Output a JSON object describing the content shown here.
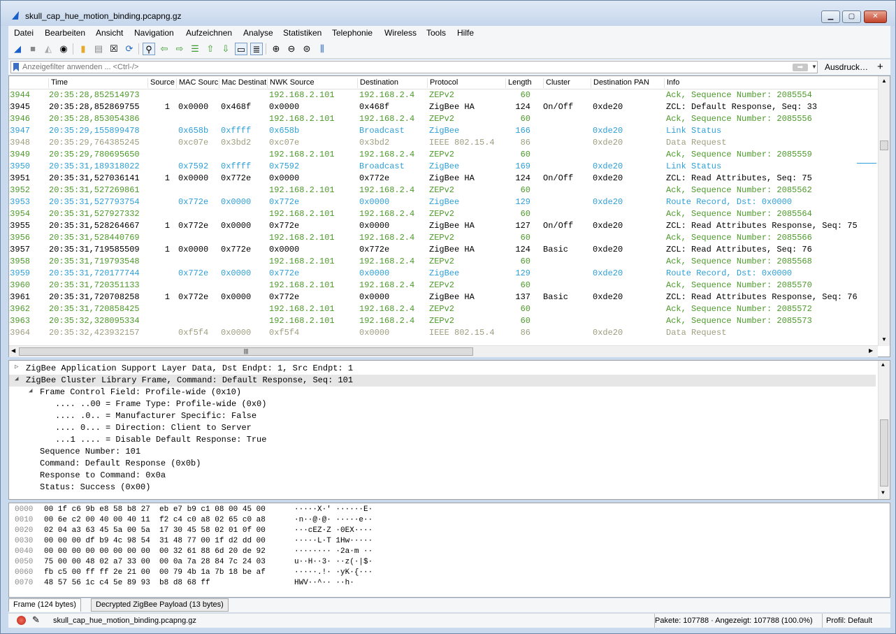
{
  "window": {
    "title": "skull_cap_hue_motion_binding.pcapng.gz"
  },
  "menu": [
    "Datei",
    "Bearbeiten",
    "Ansicht",
    "Navigation",
    "Aufzeichnen",
    "Analyse",
    "Statistiken",
    "Telephonie",
    "Wireless",
    "Tools",
    "Hilfe"
  ],
  "filter": {
    "placeholder": "Anzeigefilter anwenden ... <Ctrl-/>",
    "print_label": "Ausdruck…",
    "add_label": "+"
  },
  "columns": [
    "Time",
    "Source",
    "MAC Source",
    "Mac Destinat",
    "NWK Source",
    "Destination",
    "Protocol",
    "Length",
    "Cluster",
    "Destination PAN",
    "Info"
  ],
  "packets": [
    {
      "no": "23944",
      "time": "20:35:28,852514973",
      "src": "",
      "mac_src": "",
      "mac_dst": "",
      "nwk_src": "192.168.2.101",
      "dst": "192.168.2.4",
      "proto": "ZEPv2",
      "len": "60",
      "cluster": "",
      "dpan": "",
      "info": "Ack, Sequence Number: 2085554",
      "style": "zep"
    },
    {
      "no": "23945",
      "time": "20:35:28,852869755",
      "src": "1",
      "mac_src": "0x0000",
      "mac_dst": "0x468f",
      "nwk_src": "0x0000",
      "dst": "0x468f",
      "proto": "ZigBee HA",
      "len": "124",
      "cluster": "On/Off",
      "dpan": "0xde20",
      "info": "ZCL: Default Response, Seq: 33",
      "style": "ha"
    },
    {
      "no": "23946",
      "time": "20:35:28,853054386",
      "src": "",
      "mac_src": "",
      "mac_dst": "",
      "nwk_src": "192.168.2.101",
      "dst": "192.168.2.4",
      "proto": "ZEPv2",
      "len": "60",
      "cluster": "",
      "dpan": "",
      "info": "Ack, Sequence Number: 2085556",
      "style": "zep"
    },
    {
      "no": "23947",
      "time": "20:35:29,155899478",
      "src": "",
      "mac_src": "0x658b",
      "mac_dst": "0xffff",
      "nwk_src": "0x658b",
      "dst": "Broadcast",
      "proto": "ZigBee",
      "len": "166",
      "cluster": "",
      "dpan": "0xde20",
      "info": "Link Status",
      "style": "zb"
    },
    {
      "no": "23948",
      "time": "20:35:29,764385245",
      "src": "",
      "mac_src": "0xc07e",
      "mac_dst": "0x3bd2",
      "nwk_src": "0xc07e",
      "dst": "0x3bd2",
      "proto": "IEEE 802.15.4",
      "len": "86",
      "cluster": "",
      "dpan": "0xde20",
      "info": "Data Request",
      "style": "ieee"
    },
    {
      "no": "23949",
      "time": "20:35:29,780695650",
      "src": "",
      "mac_src": "",
      "mac_dst": "",
      "nwk_src": "192.168.2.101",
      "dst": "192.168.2.4",
      "proto": "ZEPv2",
      "len": "60",
      "cluster": "",
      "dpan": "",
      "info": "Ack, Sequence Number: 2085559",
      "style": "zep"
    },
    {
      "no": "23950",
      "time": "20:35:31,189318022",
      "src": "",
      "mac_src": "0x7592",
      "mac_dst": "0xffff",
      "nwk_src": "0x7592",
      "dst": "Broadcast",
      "proto": "ZigBee",
      "len": "169",
      "cluster": "",
      "dpan": "0xde20",
      "info": "Link Status",
      "style": "zb"
    },
    {
      "no": "23951",
      "time": "20:35:31,527036141",
      "src": "1",
      "mac_src": "0x0000",
      "mac_dst": "0x772e",
      "nwk_src": "0x0000",
      "dst": "0x772e",
      "proto": "ZigBee HA",
      "len": "124",
      "cluster": "On/Off",
      "dpan": "0xde20",
      "info": "ZCL: Read Attributes, Seq: 75",
      "style": "ha"
    },
    {
      "no": "23952",
      "time": "20:35:31,527269861",
      "src": "",
      "mac_src": "",
      "mac_dst": "",
      "nwk_src": "192.168.2.101",
      "dst": "192.168.2.4",
      "proto": "ZEPv2",
      "len": "60",
      "cluster": "",
      "dpan": "",
      "info": "Ack, Sequence Number: 2085562",
      "style": "zep"
    },
    {
      "no": "23953",
      "time": "20:35:31,527793754",
      "src": "",
      "mac_src": "0x772e",
      "mac_dst": "0x0000",
      "nwk_src": "0x772e",
      "dst": "0x0000",
      "proto": "ZigBee",
      "len": "129",
      "cluster": "",
      "dpan": "0xde20",
      "info": "Route Record, Dst: 0x0000",
      "style": "zb"
    },
    {
      "no": "23954",
      "time": "20:35:31,527927332",
      "src": "",
      "mac_src": "",
      "mac_dst": "",
      "nwk_src": "192.168.2.101",
      "dst": "192.168.2.4",
      "proto": "ZEPv2",
      "len": "60",
      "cluster": "",
      "dpan": "",
      "info": "Ack, Sequence Number: 2085564",
      "style": "zep"
    },
    {
      "no": "23955",
      "time": "20:35:31,528264667",
      "src": "1",
      "mac_src": "0x772e",
      "mac_dst": "0x0000",
      "nwk_src": "0x772e",
      "dst": "0x0000",
      "proto": "ZigBee HA",
      "len": "127",
      "cluster": "On/Off",
      "dpan": "0xde20",
      "info": "ZCL: Read Attributes Response, Seq: 75",
      "style": "ha"
    },
    {
      "no": "23956",
      "time": "20:35:31,528440769",
      "src": "",
      "mac_src": "",
      "mac_dst": "",
      "nwk_src": "192.168.2.101",
      "dst": "192.168.2.4",
      "proto": "ZEPv2",
      "len": "60",
      "cluster": "",
      "dpan": "",
      "info": "Ack, Sequence Number: 2085566",
      "style": "zep"
    },
    {
      "no": "23957",
      "time": "20:35:31,719585509",
      "src": "1",
      "mac_src": "0x0000",
      "mac_dst": "0x772e",
      "nwk_src": "0x0000",
      "dst": "0x772e",
      "proto": "ZigBee HA",
      "len": "124",
      "cluster": "Basic",
      "dpan": "0xde20",
      "info": "ZCL: Read Attributes, Seq: 76",
      "style": "ha"
    },
    {
      "no": "23958",
      "time": "20:35:31,719793548",
      "src": "",
      "mac_src": "",
      "mac_dst": "",
      "nwk_src": "192.168.2.101",
      "dst": "192.168.2.4",
      "proto": "ZEPv2",
      "len": "60",
      "cluster": "",
      "dpan": "",
      "info": "Ack, Sequence Number: 2085568",
      "style": "zep"
    },
    {
      "no": "23959",
      "time": "20:35:31,720177744",
      "src": "",
      "mac_src": "0x772e",
      "mac_dst": "0x0000",
      "nwk_src": "0x772e",
      "dst": "0x0000",
      "proto": "ZigBee",
      "len": "129",
      "cluster": "",
      "dpan": "0xde20",
      "info": "Route Record, Dst: 0x0000",
      "style": "zb"
    },
    {
      "no": "23960",
      "time": "20:35:31,720351133",
      "src": "",
      "mac_src": "",
      "mac_dst": "",
      "nwk_src": "192.168.2.101",
      "dst": "192.168.2.4",
      "proto": "ZEPv2",
      "len": "60",
      "cluster": "",
      "dpan": "",
      "info": "Ack, Sequence Number: 2085570",
      "style": "zep"
    },
    {
      "no": "23961",
      "time": "20:35:31,720708258",
      "src": "1",
      "mac_src": "0x772e",
      "mac_dst": "0x0000",
      "nwk_src": "0x772e",
      "dst": "0x0000",
      "proto": "ZigBee HA",
      "len": "137",
      "cluster": "Basic",
      "dpan": "0xde20",
      "info": "ZCL: Read Attributes Response, Seq: 76",
      "style": "ha"
    },
    {
      "no": "23962",
      "time": "20:35:31,720858425",
      "src": "",
      "mac_src": "",
      "mac_dst": "",
      "nwk_src": "192.168.2.101",
      "dst": "192.168.2.4",
      "proto": "ZEPv2",
      "len": "60",
      "cluster": "",
      "dpan": "",
      "info": "Ack, Sequence Number: 2085572",
      "style": "zep"
    },
    {
      "no": "23963",
      "time": "20:35:32,328095334",
      "src": "",
      "mac_src": "",
      "mac_dst": "",
      "nwk_src": "192.168.2.101",
      "dst": "192.168.2.4",
      "proto": "ZEPv2",
      "len": "60",
      "cluster": "",
      "dpan": "",
      "info": "Ack, Sequence Number: 2085573",
      "style": "zep"
    },
    {
      "no": "23964",
      "time": "20:35:32,423932157",
      "src": "",
      "mac_src": "0xf5f4",
      "mac_dst": "0x0000",
      "nwk_src": "0xf5f4",
      "dst": "0x0000",
      "proto": "IEEE 802.15.4",
      "len": "86",
      "cluster": "",
      "dpan": "0xde20",
      "info": "Data Request",
      "style": "ieee"
    }
  ],
  "details": [
    {
      "text": "ZigBee Application Support Layer Data, Dst Endpt: 1, Src Endpt: 1",
      "toggle": "▷",
      "indent": 0,
      "sel": false
    },
    {
      "text": "ZigBee Cluster Library Frame, Command: Default Response, Seq: 101",
      "toggle": "◢",
      "indent": 0,
      "sel": true
    },
    {
      "text": "Frame Control Field: Profile-wide (0x10)",
      "toggle": "◢",
      "indent": 1,
      "sel": false
    },
    {
      "text": ".... ..00 = Frame Type: Profile-wide (0x0)",
      "toggle": "",
      "indent": 2,
      "sel": false
    },
    {
      "text": ".... .0.. = Manufacturer Specific: False",
      "toggle": "",
      "indent": 2,
      "sel": false
    },
    {
      "text": ".... 0... = Direction: Client to Server",
      "toggle": "",
      "indent": 2,
      "sel": false
    },
    {
      "text": "...1 .... = Disable Default Response: True",
      "toggle": "",
      "indent": 2,
      "sel": false
    },
    {
      "text": "Sequence Number: 101",
      "toggle": "",
      "indent": 1,
      "sel": false
    },
    {
      "text": "Command: Default Response (0x0b)",
      "toggle": "",
      "indent": 1,
      "sel": false
    },
    {
      "text": "Response to Command: 0x0a",
      "toggle": "",
      "indent": 1,
      "sel": false
    },
    {
      "text": "Status: Success (0x00)",
      "toggle": "",
      "indent": 1,
      "sel": false
    }
  ],
  "bytes": [
    {
      "off": "0000",
      "hex": "00 1f c6 9b e8 58 b8 27  eb e7 b9 c1 08 00 45 00",
      "asc": "·····X·' ······E·"
    },
    {
      "off": "0010",
      "hex": "00 6e c2 00 40 00 40 11  f2 c4 c0 a8 02 65 c0 a8",
      "asc": "·n··@·@· ·····e··"
    },
    {
      "off": "0020",
      "hex": "02 04 a3 63 45 5a 00 5a  17 30 45 58 02 01 0f 00",
      "asc": "···cEZ·Z ·0EX····"
    },
    {
      "off": "0030",
      "hex": "00 00 00 df b9 4c 98 54  31 48 77 00 1f d2 dd 00",
      "asc": "·····L·T 1Hw·····"
    },
    {
      "off": "0040",
      "hex": "00 00 00 00 00 00 00 00  00 32 61 88 6d 20 de 92",
      "asc": "········ ·2a·m ··"
    },
    {
      "off": "0050",
      "hex": "75 00 00 48 02 a7 33 00  00 0a 7a 28 84 7c 24 03",
      "asc": "u··H··3· ··z(·|$·"
    },
    {
      "off": "0060",
      "hex": "fb c5 00 ff ff 2e 21 00  00 79 4b 1a 7b 18 be af",
      "asc": "·····.!· ·yK·{···"
    },
    {
      "off": "0070",
      "hex": "48 57 56 1c c4 5e 89 93  b8 d8 68 ff",
      "asc": "HWV··^·· ··h·"
    }
  ],
  "tabs": [
    "Frame (124 bytes)",
    "Decrypted ZigBee Payload (13 bytes)"
  ],
  "status": {
    "file": "skull_cap_hue_motion_binding.pcapng.gz",
    "packets": "Pakete: 107788 · Angezeigt: 107788 (100.0%)",
    "profile": "Profil: Default"
  },
  "colors": {
    "zep": "#4c9a2a",
    "zigbee": "#2e9fd8",
    "ieee": "#9e9e80",
    "ha": "#000000"
  }
}
